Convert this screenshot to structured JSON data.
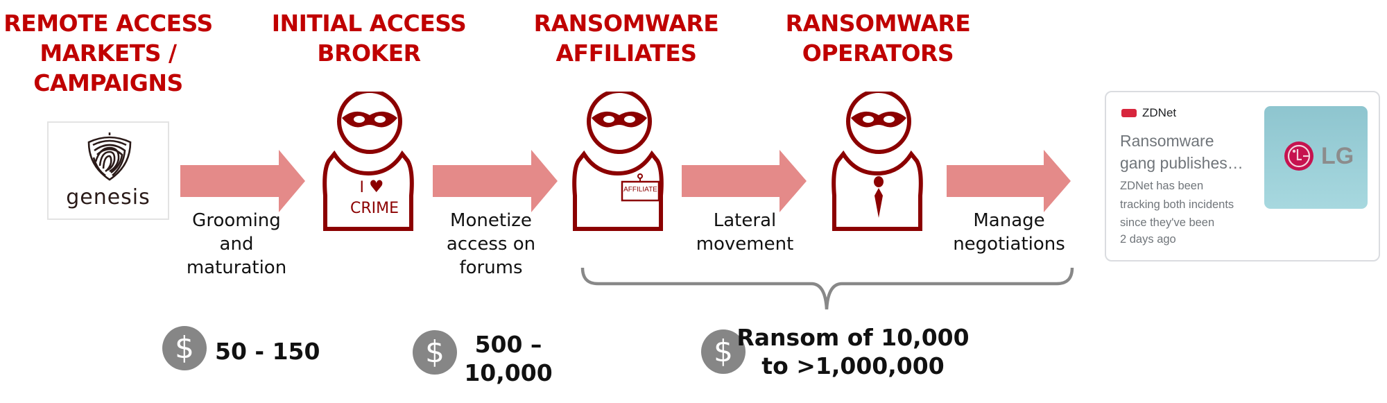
{
  "stages": [
    {
      "title_line1": "REMOTE ACCESS",
      "title_line2": "MARKETS /",
      "title_line3": "CAMPAIGNS",
      "logo_text": "genesis"
    },
    {
      "title_line1": "INITIAL ACCESS",
      "title_line2": "BROKER",
      "shirt_line1": "I",
      "shirt_heart": "♥",
      "shirt_line2": "CRIME"
    },
    {
      "title_line1": "RANSOMWARE",
      "title_line2": "AFFILIATES",
      "badge_text": "AFFILIATE"
    },
    {
      "title_line1": "RANSOMWARE",
      "title_line2": "OPERATORS"
    }
  ],
  "steps": [
    {
      "line1": "Grooming",
      "line2": "and",
      "line3": "maturation"
    },
    {
      "line1": "Monetize",
      "line2": "access on",
      "line3": "forums"
    },
    {
      "line1": "Lateral",
      "line2": "movement"
    },
    {
      "line1": "Manage",
      "line2": "negotiations"
    }
  ],
  "prices": [
    {
      "icon": "dollar-icon",
      "symbol": "$",
      "line1": "50 - 150"
    },
    {
      "icon": "dollar-icon",
      "symbol": "$",
      "line1": "500 –",
      "line2": "10,000"
    },
    {
      "icon": "dollar-icon",
      "symbol": "$",
      "line1": "Ransom of 10,000",
      "line2": "to >1,000,000"
    }
  ],
  "news_card": {
    "source": "ZDNet",
    "headline_line1": "Ransomware",
    "headline_line2": "gang publishes…",
    "snippet_line1": "ZDNet has been",
    "snippet_line2": "tracking both incidents",
    "snippet_line3": "since they've been",
    "time": "2 days ago",
    "thumbnail_text": "LG"
  },
  "colors": {
    "title_red": "#C00000",
    "figure_red": "#8B0000",
    "arrow_pink": "#E48A89",
    "brace_gray": "#888888",
    "dollar_gray": "#868686"
  }
}
